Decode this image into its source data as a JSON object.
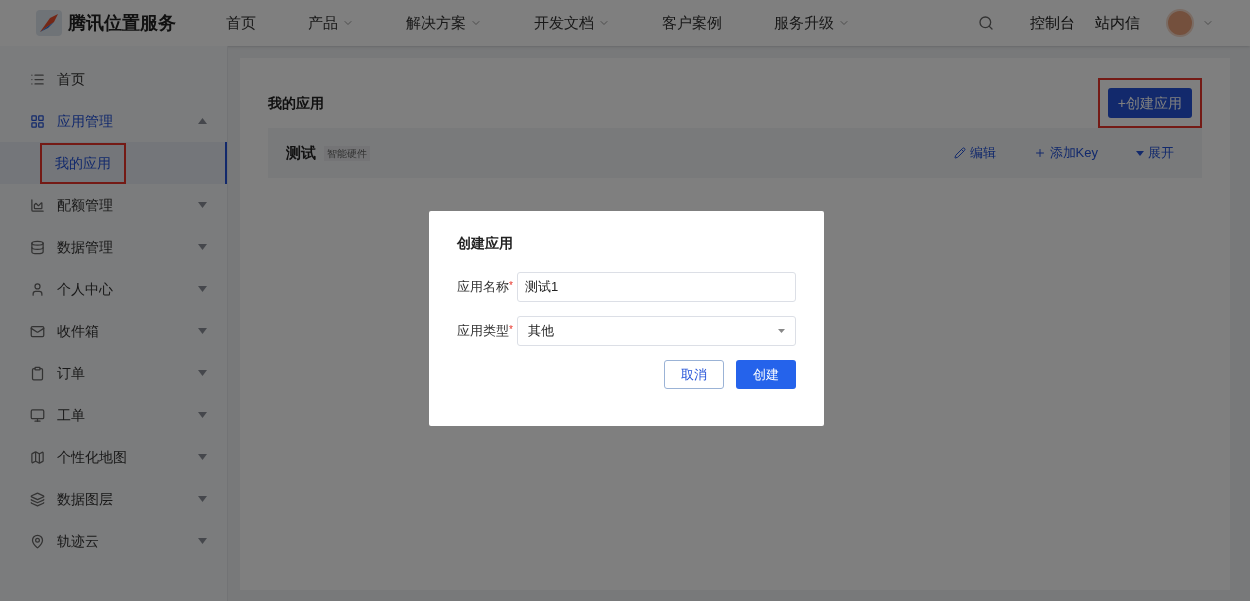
{
  "header": {
    "logo_text": "腾讯位置服务",
    "nav": [
      {
        "label": "首页",
        "has_menu": false
      },
      {
        "label": "产品",
        "has_menu": true
      },
      {
        "label": "解决方案",
        "has_menu": true
      },
      {
        "label": "开发文档",
        "has_menu": true
      },
      {
        "label": "客户案例",
        "has_menu": false
      },
      {
        "label": "服务升级",
        "has_menu": true
      }
    ],
    "links": [
      "控制台",
      "站内信"
    ]
  },
  "sidebar": {
    "items": [
      {
        "label": "首页",
        "has_menu": false,
        "selected": false
      },
      {
        "label": "应用管理",
        "expanded": true,
        "has_menu": true,
        "selected": true,
        "children": [
          {
            "label": "我的应用",
            "selected": true,
            "highlighted": true
          }
        ]
      },
      {
        "label": "配额管理",
        "expanded": false,
        "has_menu": true,
        "selected": false
      },
      {
        "label": "数据管理",
        "expanded": false,
        "has_menu": true,
        "selected": false
      },
      {
        "label": "个人中心",
        "expanded": false,
        "has_menu": true,
        "selected": false
      },
      {
        "label": " 收件箱",
        "expanded": false,
        "has_menu": true,
        "selected": false
      },
      {
        "label": "订单",
        "expanded": false,
        "has_menu": true,
        "selected": false
      },
      {
        "label": "工单",
        "expanded": false,
        "has_menu": true,
        "selected": false
      },
      {
        "label": "个性化地图",
        "expanded": false,
        "has_menu": true,
        "selected": false
      },
      {
        "label": "数据图层",
        "expanded": false,
        "has_menu": true,
        "selected": false
      },
      {
        "label": "轨迹云",
        "expanded": false,
        "has_menu": true,
        "selected": false
      }
    ]
  },
  "page": {
    "title": "我的应用",
    "create_button": {
      "label": "+创建应用",
      "highlighted": true
    },
    "apps": [
      {
        "name": "测试",
        "tag": "智能硬件",
        "actions": [
          {
            "kind": "edit",
            "label": "编辑"
          },
          {
            "kind": "add",
            "label": "添加Key"
          },
          {
            "kind": "expand",
            "label": "展开"
          }
        ]
      }
    ]
  },
  "dialog": {
    "title": "创建应用",
    "fields": [
      {
        "kind": "text",
        "label": "应用名称",
        "required_mark": "*",
        "value": "测试1"
      },
      {
        "kind": "select",
        "label": "应用类型",
        "required_mark": "*",
        "value": "其他"
      }
    ],
    "buttons": [
      {
        "kind": "secondary",
        "label": "取消"
      },
      {
        "kind": "primary",
        "label": "创建"
      }
    ]
  }
}
